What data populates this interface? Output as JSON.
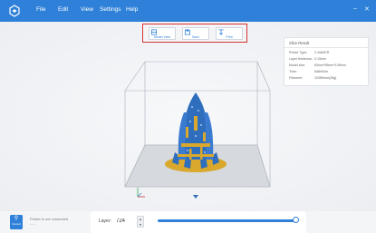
{
  "menubar": {
    "items": [
      "File",
      "Edit",
      "View",
      "Settings",
      "Help"
    ],
    "controls": {
      "minimize": "–",
      "close": "✕"
    }
  },
  "toolbar": {
    "model_view_label": "Model View",
    "save_label": "Save",
    "print_label": "Print"
  },
  "slice_result": {
    "title": "Slice Result",
    "rows": [
      {
        "label": "Printer Type:",
        "value": "X-MAKER"
      },
      {
        "label": "Layer thickness:",
        "value": "0.15mm"
      },
      {
        "label": "Model size:",
        "value": "83mm*55mm*108mm"
      },
      {
        "label": "Time:",
        "value": "5d8h54m"
      },
      {
        "label": "Filament:",
        "value": "10389mm(28g)"
      }
    ]
  },
  "bottom": {
    "connect_label": "Connect",
    "status_text": "Printer is not connected",
    "status_sub": "-----",
    "layer_label": "Layer:",
    "layer_value": "724",
    "slider_fraction": 1.0
  },
  "colors": {
    "accent": "#2f80d8",
    "highlight_frame": "#d63333",
    "model_blue": "#2f6ebd",
    "model_support": "#d9a82c"
  }
}
